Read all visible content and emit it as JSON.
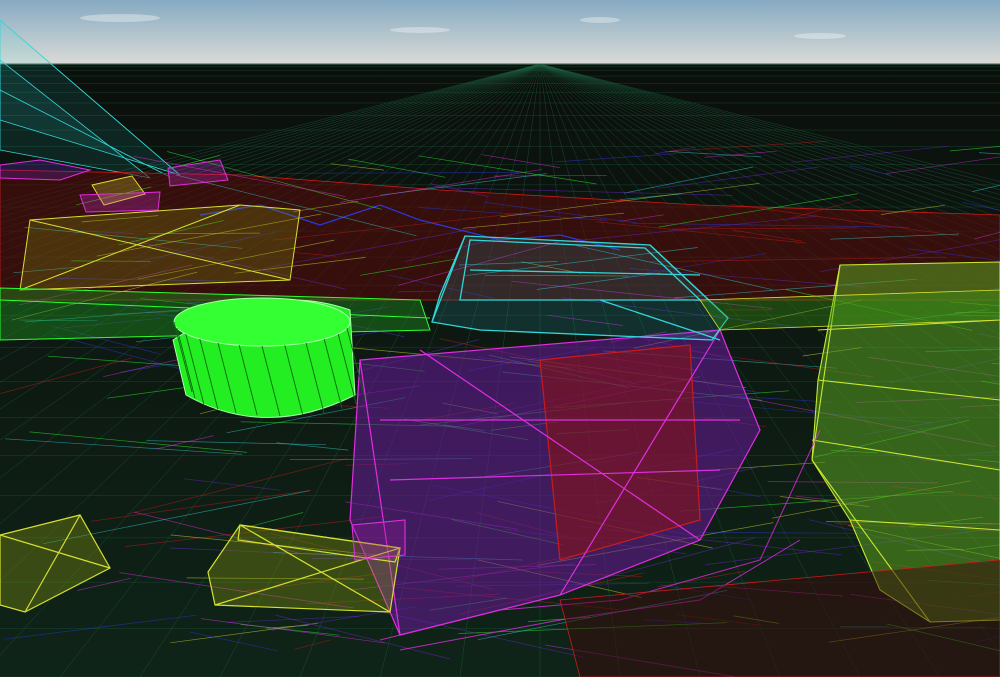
{
  "scene": {
    "kind": "3d-wireframe-debug-view",
    "sky": {
      "top": "#8fb2c8",
      "horizon": "#d9dcd8"
    },
    "ground": "#0a1410",
    "layer_colors": {
      "green": "#2cff2c",
      "yellow": "#d6e030",
      "magenta": "#e02ee0",
      "purple": "#6a2ad0",
      "red": "#c81c1c",
      "cyan": "#33d6d6",
      "blue": "#2a3ae0"
    },
    "selected_object": {
      "name": "cylinder",
      "color": "#22ff22"
    }
  }
}
